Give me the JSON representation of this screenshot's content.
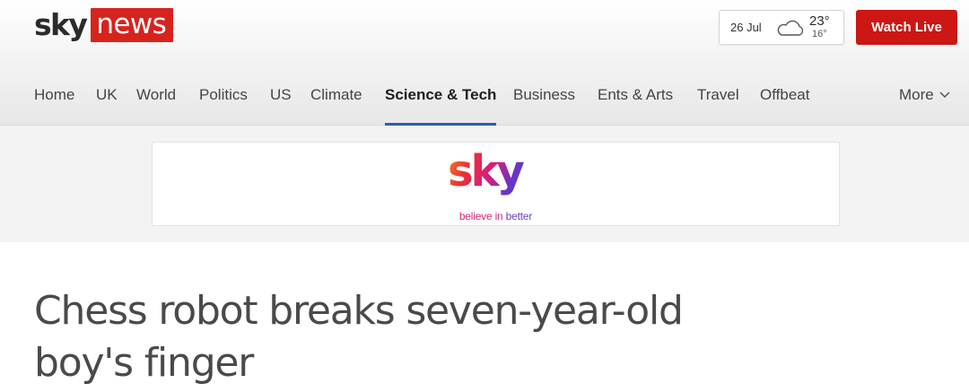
{
  "header": {
    "logo": {
      "sky": "sky",
      "news": "news"
    },
    "weather": {
      "date": "26 Jul",
      "high": "23°",
      "low": "16°",
      "icon": "cloud-icon"
    },
    "watch_live_label": "Watch Live"
  },
  "nav": {
    "items": [
      {
        "label": "Home"
      },
      {
        "label": "UK"
      },
      {
        "label": "World"
      },
      {
        "label": "Politics"
      },
      {
        "label": "US"
      },
      {
        "label": "Climate"
      },
      {
        "label": "Science & Tech",
        "active": true
      },
      {
        "label": "Business"
      },
      {
        "label": "Ents & Arts"
      },
      {
        "label": "Travel"
      },
      {
        "label": "Offbeat"
      }
    ],
    "more_label": "More"
  },
  "ad": {
    "brand": "sky",
    "tagline_believe": "believe in",
    "tagline_better": "better"
  },
  "article": {
    "headline": "Chess robot breaks seven-year-old boy's finger"
  },
  "colors": {
    "brand_red": "#d7231e",
    "watch_live_bg": "#cc1714",
    "nav_active_underline": "#2e5da8"
  }
}
